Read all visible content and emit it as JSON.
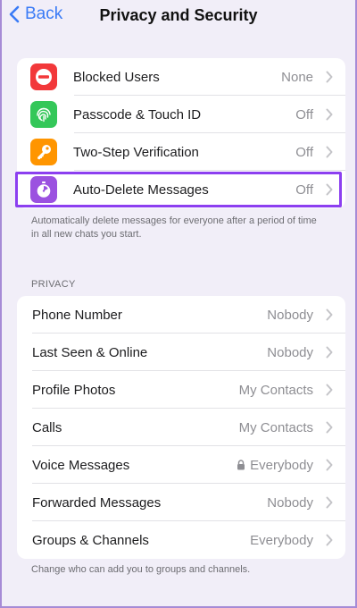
{
  "nav": {
    "back_label": "Back",
    "title": "Privacy and Security"
  },
  "security_items": [
    {
      "label": "Blocked Users",
      "value": "None",
      "icon": "blocked-icon",
      "color": "#f2383a"
    },
    {
      "label": "Passcode & Touch ID",
      "value": "Off",
      "icon": "fingerprint-icon",
      "color": "#34c759"
    },
    {
      "label": "Two-Step Verification",
      "value": "Off",
      "icon": "key-icon",
      "color": "#ff9500"
    },
    {
      "label": "Auto-Delete Messages",
      "value": "Off",
      "icon": "timer-icon",
      "color": "#9b51e0"
    }
  ],
  "auto_delete_footnote": "Automatically delete messages for everyone after a period of time in all new chats you start.",
  "privacy": {
    "header": "PRIVACY",
    "items": [
      {
        "label": "Phone Number",
        "value": "Nobody"
      },
      {
        "label": "Last Seen & Online",
        "value": "Nobody"
      },
      {
        "label": "Profile Photos",
        "value": "My Contacts"
      },
      {
        "label": "Calls",
        "value": "My Contacts"
      },
      {
        "label": "Voice Messages",
        "value": "Everybody",
        "locked": true
      },
      {
        "label": "Forwarded Messages",
        "value": "Nobody"
      },
      {
        "label": "Groups & Channels",
        "value": "Everybody"
      }
    ],
    "footnote": "Change who can add you to groups and channels."
  },
  "colors": {
    "accent": "#3a7bf6",
    "highlight": "#8c3ff0",
    "background": "#f1eef8"
  }
}
